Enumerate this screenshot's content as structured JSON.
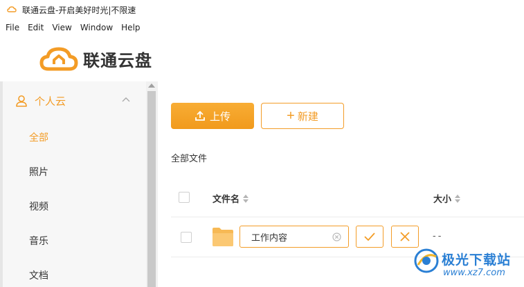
{
  "window": {
    "title": "联通云盘-开启美好时光|不限速"
  },
  "menu": [
    "File",
    "Edit",
    "View",
    "Window",
    "Help"
  ],
  "brand": {
    "name": "联通云盘",
    "accent_color": "#f39c26"
  },
  "sidebar": {
    "section_label": "个人云",
    "items": [
      {
        "label": "全部",
        "active": true
      },
      {
        "label": "照片",
        "active": false
      },
      {
        "label": "视频",
        "active": false
      },
      {
        "label": "音乐",
        "active": false
      },
      {
        "label": "文档",
        "active": false
      }
    ]
  },
  "toolbar": {
    "upload_label": "上传",
    "new_label": "新建"
  },
  "breadcrumb": "全部文件",
  "table": {
    "columns": [
      "文件名",
      "大小"
    ],
    "rows": [
      {
        "name_input": "工作内容",
        "size": "--",
        "icon": "folder-icon"
      }
    ]
  },
  "watermark": {
    "title": "极光下载站",
    "url": "www.xz7.com"
  }
}
